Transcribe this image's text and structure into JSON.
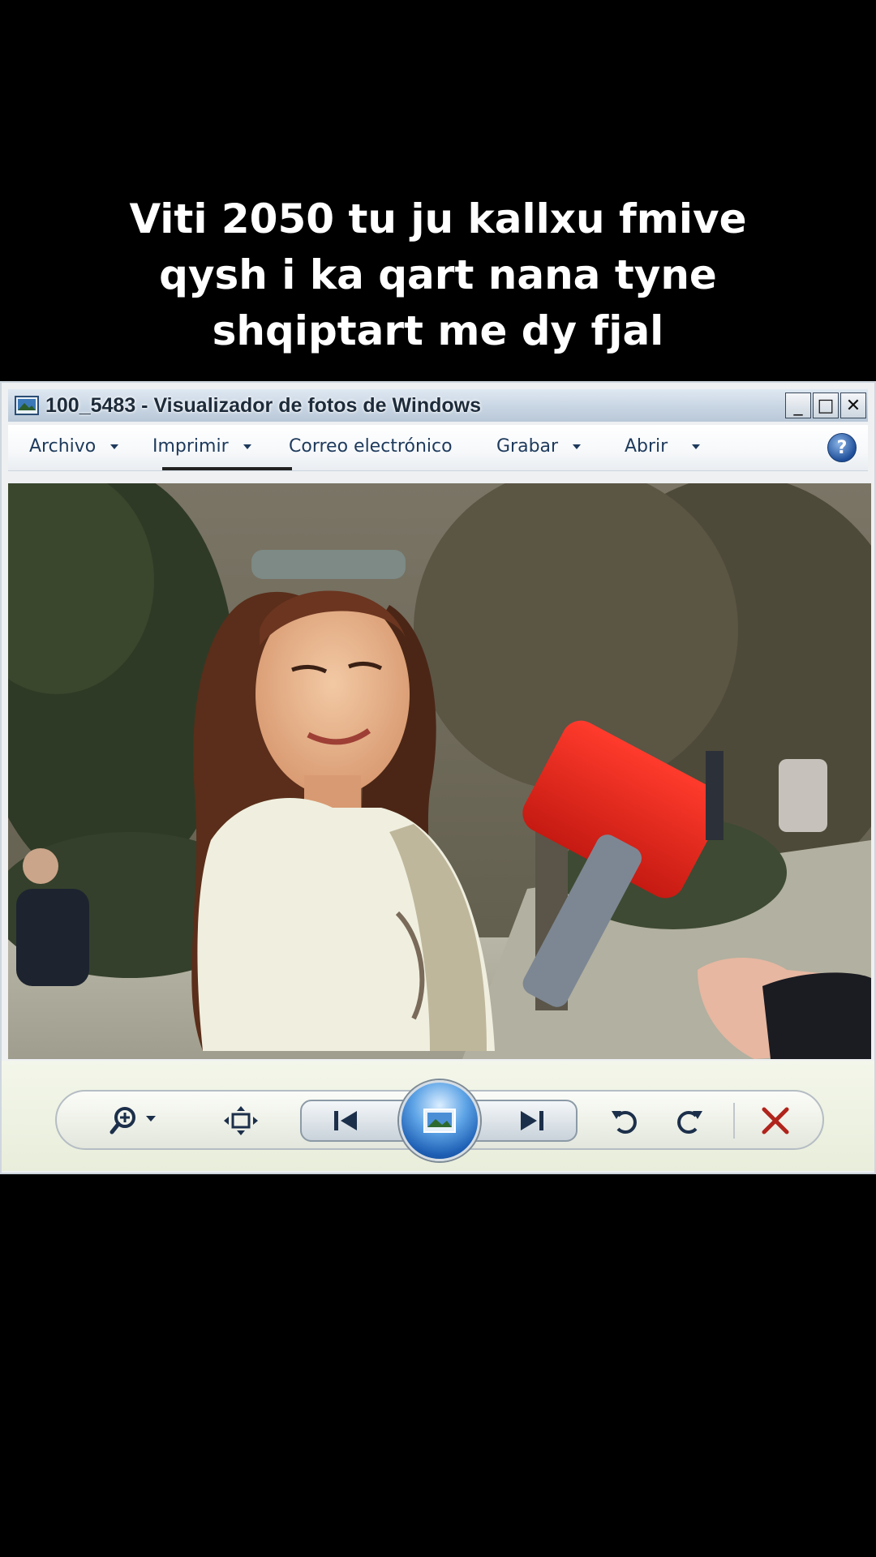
{
  "caption": {
    "lines": [
      "Viti 2050 tu ju kallxu fmive",
      "qysh i ka qart nana tyne",
      "shqiptart me dy fjal"
    ]
  },
  "window": {
    "title": "100_5483 - Visualizador de fotos de Windows",
    "controls": {
      "minimize": "_",
      "maximize": "□",
      "close": "✕"
    }
  },
  "menu": {
    "items": [
      {
        "label": "Archivo",
        "has_dropdown": true
      },
      {
        "label": "Imprimir",
        "has_dropdown": true
      },
      {
        "label": "Correo electrónico",
        "has_dropdown": false
      },
      {
        "label": "Grabar",
        "has_dropdown": true
      },
      {
        "label": "Abrir",
        "has_dropdown": true
      }
    ],
    "help_label": "?"
  },
  "toolbar": {
    "icons": [
      "zoom-icon",
      "fit-window-icon",
      "previous-icon",
      "slideshow-icon",
      "next-icon",
      "rotate-counterclockwise-icon",
      "rotate-clockwise-icon",
      "delete-icon"
    ]
  },
  "colors": {
    "background": "#000000",
    "caption_text": "#ffffff",
    "menu_text": "#1e3a5c",
    "delete_icon": "#b0241c",
    "slideshow_blue": "#1e5fb4"
  }
}
